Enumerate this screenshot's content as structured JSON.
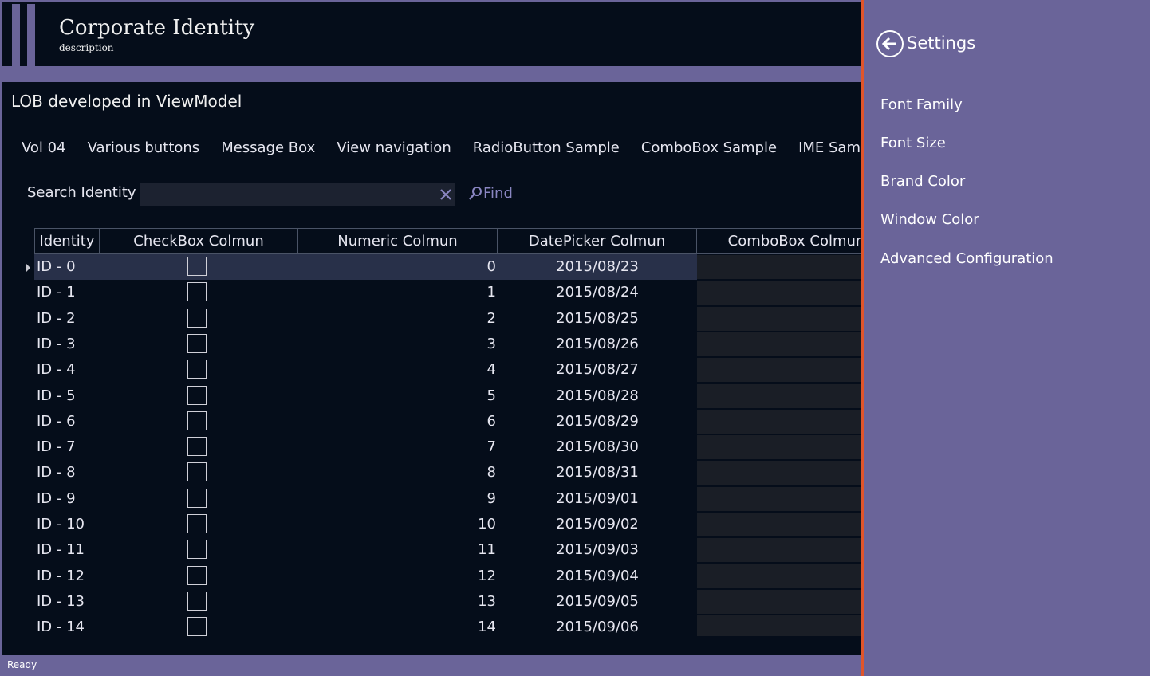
{
  "header": {
    "title": "Corporate Identity",
    "description": "description"
  },
  "page_heading": "LOB developed in ViewModel",
  "tabs": [
    {
      "label": "Vol 04"
    },
    {
      "label": "Various buttons"
    },
    {
      "label": "Message Box"
    },
    {
      "label": "View navigation"
    },
    {
      "label": "RadioButton Sample"
    },
    {
      "label": "ComboBox Sample"
    },
    {
      "label": "IME Sample"
    }
  ],
  "search": {
    "label": "Search Identity",
    "value": "",
    "find_label": "Find"
  },
  "grid": {
    "columns": [
      "Identity",
      "CheckBox Colmun",
      "Numeric Colmun",
      "DatePicker Colmun",
      "ComboBox Colmun"
    ],
    "selected_row": 0,
    "rows": [
      {
        "id": "ID - 0",
        "checked": false,
        "num": "0",
        "date": "2015/08/23"
      },
      {
        "id": "ID - 1",
        "checked": false,
        "num": "1",
        "date": "2015/08/24"
      },
      {
        "id": "ID - 2",
        "checked": false,
        "num": "2",
        "date": "2015/08/25"
      },
      {
        "id": "ID - 3",
        "checked": false,
        "num": "3",
        "date": "2015/08/26"
      },
      {
        "id": "ID - 4",
        "checked": false,
        "num": "4",
        "date": "2015/08/27"
      },
      {
        "id": "ID - 5",
        "checked": false,
        "num": "5",
        "date": "2015/08/28"
      },
      {
        "id": "ID - 6",
        "checked": false,
        "num": "6",
        "date": "2015/08/29"
      },
      {
        "id": "ID - 7",
        "checked": false,
        "num": "7",
        "date": "2015/08/30"
      },
      {
        "id": "ID - 8",
        "checked": false,
        "num": "8",
        "date": "2015/08/31"
      },
      {
        "id": "ID - 9",
        "checked": false,
        "num": "9",
        "date": "2015/09/01"
      },
      {
        "id": "ID - 10",
        "checked": false,
        "num": "10",
        "date": "2015/09/02"
      },
      {
        "id": "ID - 11",
        "checked": false,
        "num": "11",
        "date": "2015/09/03"
      },
      {
        "id": "ID - 12",
        "checked": false,
        "num": "12",
        "date": "2015/09/04"
      },
      {
        "id": "ID - 13",
        "checked": false,
        "num": "13",
        "date": "2015/09/05"
      },
      {
        "id": "ID - 14",
        "checked": false,
        "num": "14",
        "date": "2015/09/06"
      }
    ]
  },
  "status": "Ready",
  "settings": {
    "title": "Settings",
    "back_icon": "arrow-left-circle-icon",
    "items": [
      {
        "label": "Font Family"
      },
      {
        "label": "Font Size"
      },
      {
        "label": "Brand Color"
      },
      {
        "label": "Window Color"
      },
      {
        "label": "Advanced Configuration"
      }
    ]
  },
  "colors": {
    "brand": "#6a6499",
    "background": "#050d1a",
    "accent_border": "#e0552b",
    "find_text": "#8a86c2"
  }
}
